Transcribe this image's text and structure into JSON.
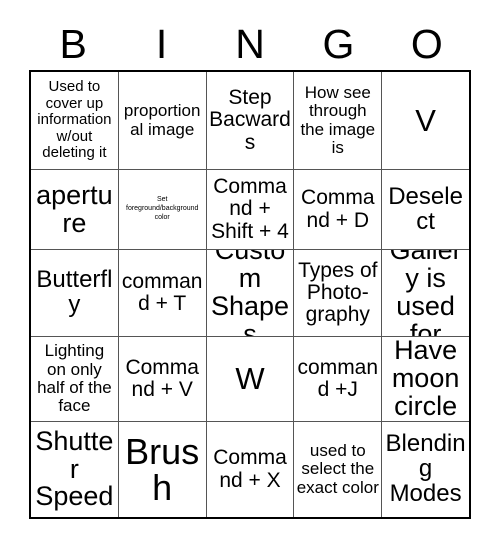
{
  "card": {
    "title": "BINGO",
    "header_letters": [
      "B",
      "I",
      "N",
      "G",
      "O"
    ],
    "grid_size": "5x5",
    "colors": {
      "background": "#ffffff",
      "text": "#000000",
      "grid_line": "#555555",
      "outer_border": "#000000"
    },
    "rows": [
      {
        "cells": [
          {
            "text": "Used to cover up information w/out deleting it",
            "size": "sm"
          },
          {
            "text": "proportional image",
            "size": "md"
          },
          {
            "text": "Step Bacwards",
            "size": "xl"
          },
          {
            "text": "How see through the image is",
            "size": "md"
          },
          {
            "text": "V",
            "size": "h2"
          }
        ]
      },
      {
        "cells": [
          {
            "text": "aperture",
            "size": "h1"
          },
          {
            "text": "Set foreground/background color",
            "size": "xxs"
          },
          {
            "text": "Command + Shift + 4",
            "size": "xl"
          },
          {
            "text": "Command + D",
            "size": "xl"
          },
          {
            "text": "Deselect",
            "size": "xxl"
          }
        ]
      },
      {
        "cells": [
          {
            "text": "Butterfly",
            "size": "xxl"
          },
          {
            "text": "command + T",
            "size": "xl"
          },
          {
            "text": "Custom Shapes",
            "size": "h1"
          },
          {
            "text": "Types of Photo-graphy",
            "size": "xl"
          },
          {
            "text": "Gallery is used for",
            "size": "h1"
          }
        ]
      },
      {
        "cells": [
          {
            "text": "Lighting on only half of the face",
            "size": "md"
          },
          {
            "text": "Command + V",
            "size": "xl"
          },
          {
            "text": "W",
            "size": "h2"
          },
          {
            "text": "command +J",
            "size": "xl"
          },
          {
            "text": "Have moon circle",
            "size": "h1"
          }
        ]
      },
      {
        "cells": [
          {
            "text": "Shutter Speed",
            "size": "h1"
          },
          {
            "text": "Brush",
            "size": "mega"
          },
          {
            "text": "Command + X",
            "size": "xl"
          },
          {
            "text": "used to select the exact color",
            "size": "md"
          },
          {
            "text": "Blending Modes",
            "size": "xxl"
          }
        ]
      }
    ]
  }
}
